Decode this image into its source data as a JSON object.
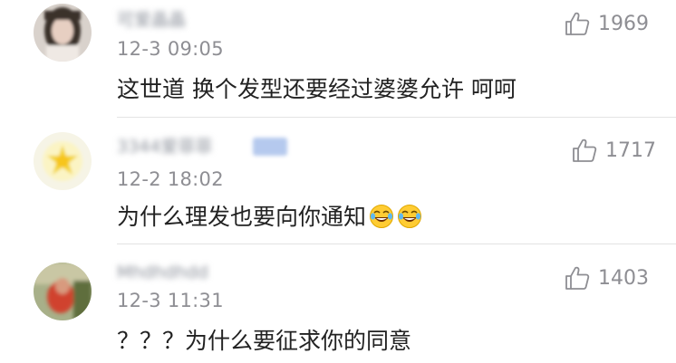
{
  "comments": [
    {
      "username": "可爱晶晶",
      "timestamp": "12-3 09:05",
      "text": "这世道 换个发型还要经过婆婆允许 呵呵",
      "likes": "1969",
      "has_vip_badge": false,
      "emoji": []
    },
    {
      "username": "3344爱菲菲",
      "timestamp": "12-2 18:02",
      "text": "为什么理发也要向你通知",
      "likes": "1717",
      "has_vip_badge": true,
      "emoji": [
        "tears-of-joy-icon",
        "tears-of-joy-icon"
      ]
    },
    {
      "username": "Mhdhdhdd",
      "timestamp": "12-3 11:31",
      "text": "？？？为什么要征求你的同意",
      "likes": "1403",
      "has_vip_badge": false,
      "emoji": []
    }
  ],
  "colors": {
    "text_primary": "#222222",
    "text_secondary": "#8e8e93",
    "divider": "#e3e3e3",
    "vip_badge": "#b5c9ee"
  },
  "icons": [
    "thumbs-up-icon",
    "tears-of-joy-icon"
  ]
}
